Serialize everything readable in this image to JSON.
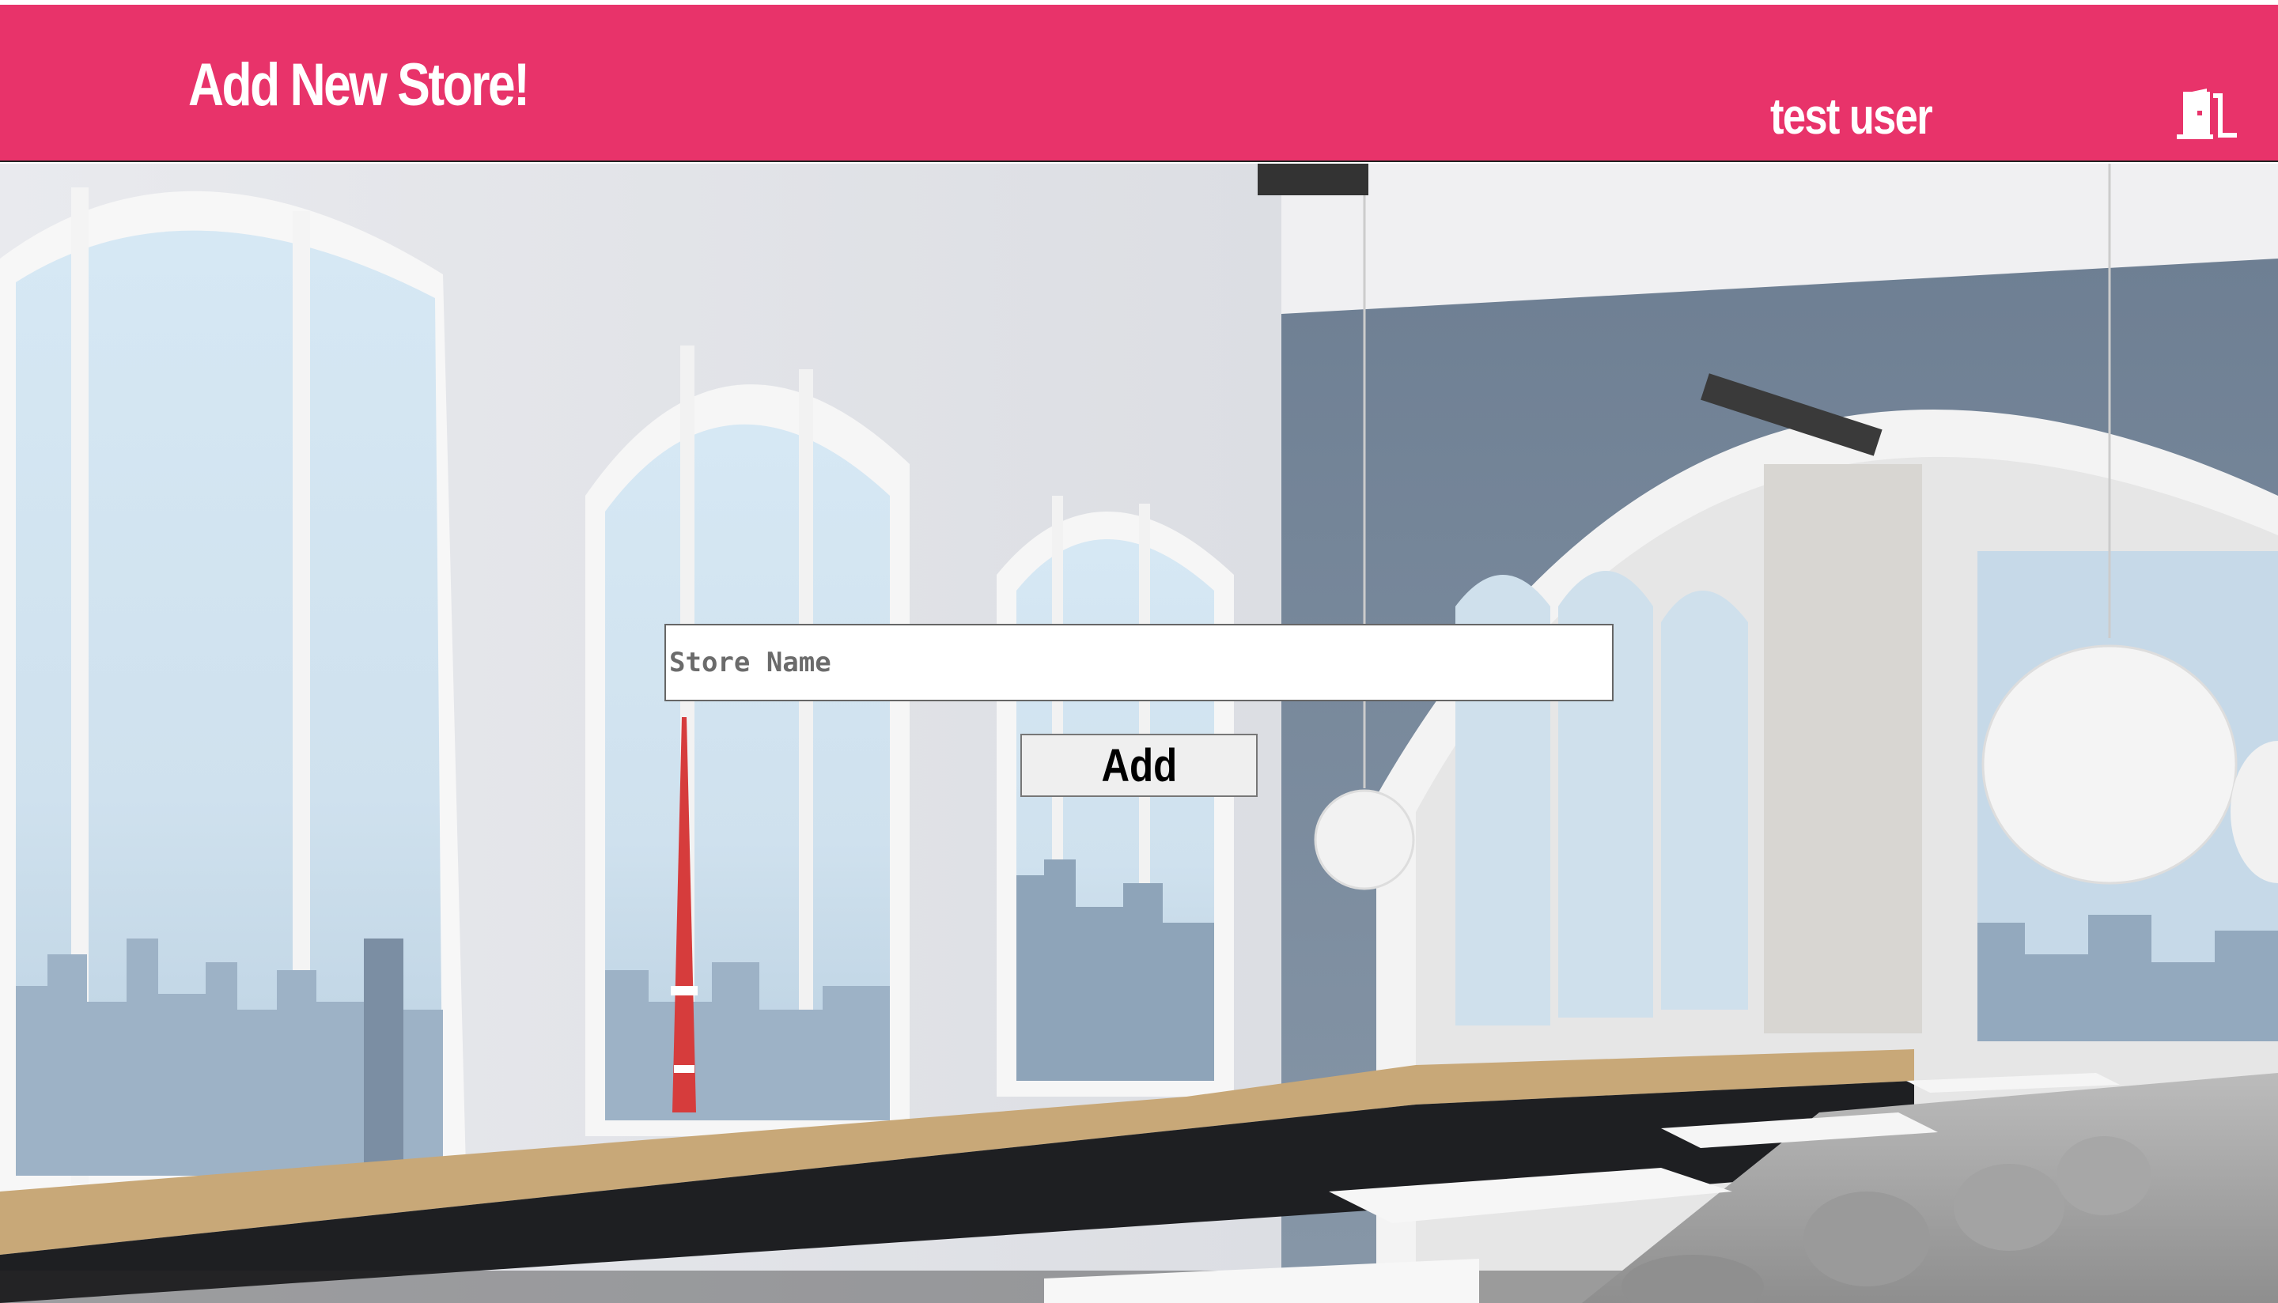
{
  "header": {
    "title": "Add New Store!",
    "user_name": "test user",
    "logout_icon": "door-exit-icon"
  },
  "form": {
    "store_name_placeholder": "Store Name",
    "store_name_value": "",
    "add_button_label": "Add"
  },
  "colors": {
    "header_background": "#e8336a",
    "header_text": "#ffffff",
    "button_background": "#efefef"
  },
  "background": {
    "icon": "restaurant-interior-photo"
  }
}
